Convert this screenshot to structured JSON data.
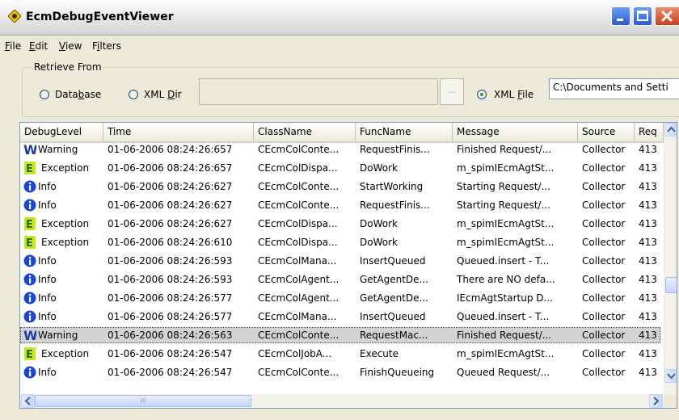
{
  "window": {
    "title": "EcmDebugEventViewer"
  },
  "menu": [
    {
      "label": "File",
      "mnemonic": "F",
      "rest": "ile"
    },
    {
      "label": "Edit",
      "mnemonic": "E",
      "rest": "dit"
    },
    {
      "label": "View",
      "mnemonic": "V",
      "rest": "iew"
    },
    {
      "label": "Filters",
      "pre": "F",
      "mnemonic": "i",
      "rest": "lters"
    }
  ],
  "retrieve": {
    "group_label": "Retrieve From",
    "database": {
      "pre": "Data",
      "mnemonic": "b",
      "rest": "ase",
      "checked": false
    },
    "xmldir": {
      "pre": "XML ",
      "mnemonic": "D",
      "rest": "ir",
      "checked": false
    },
    "xmlfile": {
      "pre": "XML ",
      "mnemonic": "F",
      "rest": "ile",
      "checked": true
    },
    "dir_value": "",
    "browse_label": "...",
    "file_path": "C:\\Documents and Setti"
  },
  "table": {
    "columns": [
      "DebugLevel",
      "Time",
      "ClassName",
      "FuncName",
      "Message",
      "Source",
      "Req"
    ],
    "rows": [
      {
        "level": "Warning",
        "icon": "warning-icon",
        "time": "01-06-2006 08:24:26:657",
        "class": "CEcmColConte...",
        "func": "RequestFinis...",
        "msg": "Finished Request/...",
        "source": "Collector",
        "req": "413"
      },
      {
        "level": "Exception",
        "icon": "exception-icon",
        "time": "01-06-2006 08:24:26:657",
        "class": "CEcmColDispa...",
        "func": "DoWork",
        "msg": "m_spimIEcmAgtSt...",
        "source": "Collector",
        "req": "413"
      },
      {
        "level": "Info",
        "icon": "info-icon",
        "time": "01-06-2006 08:24:26:627",
        "class": "CEcmColConte...",
        "func": "StartWorking",
        "msg": "Starting Request/...",
        "source": "Collector",
        "req": "413"
      },
      {
        "level": "Info",
        "icon": "info-icon",
        "time": "01-06-2006 08:24:26:627",
        "class": "CEcmColConte...",
        "func": "RequestFinis...",
        "msg": "Starting Request/...",
        "source": "Collector",
        "req": "413"
      },
      {
        "level": "Exception",
        "icon": "exception-icon",
        "time": "01-06-2006 08:24:26:627",
        "class": "CEcmColDispa...",
        "func": "DoWork",
        "msg": "m_spimIEcmAgtSt...",
        "source": "Collector",
        "req": "413"
      },
      {
        "level": "Exception",
        "icon": "exception-icon",
        "time": "01-06-2006 08:24:26:610",
        "class": "CEcmColDispa...",
        "func": "DoWork",
        "msg": "m_spimIEcmAgtSt...",
        "source": "Collector",
        "req": "413"
      },
      {
        "level": "Info",
        "icon": "info-icon",
        "time": "01-06-2006 08:24:26:593",
        "class": "CEcmColMana...",
        "func": "InsertQueued",
        "msg": "Queued.insert - T...",
        "source": "Collector",
        "req": "413"
      },
      {
        "level": "Info",
        "icon": "info-icon",
        "time": "01-06-2006 08:24:26:593",
        "class": "CEcmColAgent...",
        "func": "GetAgentDe...",
        "msg": "There are NO defa...",
        "source": "Collector",
        "req": "413"
      },
      {
        "level": "Info",
        "icon": "info-icon",
        "time": "01-06-2006 08:24:26:577",
        "class": "CEcmColAgent...",
        "func": "GetAgentDe...",
        "msg": "IEcmAgtStartup D...",
        "source": "Collector",
        "req": "413"
      },
      {
        "level": "Info",
        "icon": "info-icon",
        "time": "01-06-2006 08:24:26:577",
        "class": "CEcmColMana...",
        "func": "InsertQueued",
        "msg": "Queued.insert - T...",
        "source": "Collector",
        "req": "413"
      },
      {
        "level": "Warning",
        "icon": "warning-icon",
        "time": "01-06-2006 08:24:26:563",
        "class": "CEcmColConte...",
        "func": "RequestMac...",
        "msg": "Finished Request/...",
        "source": "Collector",
        "req": "413",
        "selected": true
      },
      {
        "level": "Exception",
        "icon": "exception-icon",
        "time": "01-06-2006 08:24:26:547",
        "class": "CEcmColJobA...",
        "func": "Execute",
        "msg": "m_spimIEcmAgtSt...",
        "source": "Collector",
        "req": "413"
      },
      {
        "level": "Info",
        "icon": "info-icon",
        "time": "01-06-2006 08:24:26:547",
        "class": "CEcmColConte...",
        "func": "FinishQueueing",
        "msg": "Queued Request/...",
        "source": "Collector",
        "req": "413"
      }
    ]
  },
  "scrollbar": {
    "hscroll_grip": "III"
  },
  "colors": {
    "warning": "#1a3ea8",
    "exception_bg": "#c8e61e",
    "exception_fg": "#1f6e1f",
    "info": "#1846d6",
    "selected_row": "#d3d3d3"
  }
}
